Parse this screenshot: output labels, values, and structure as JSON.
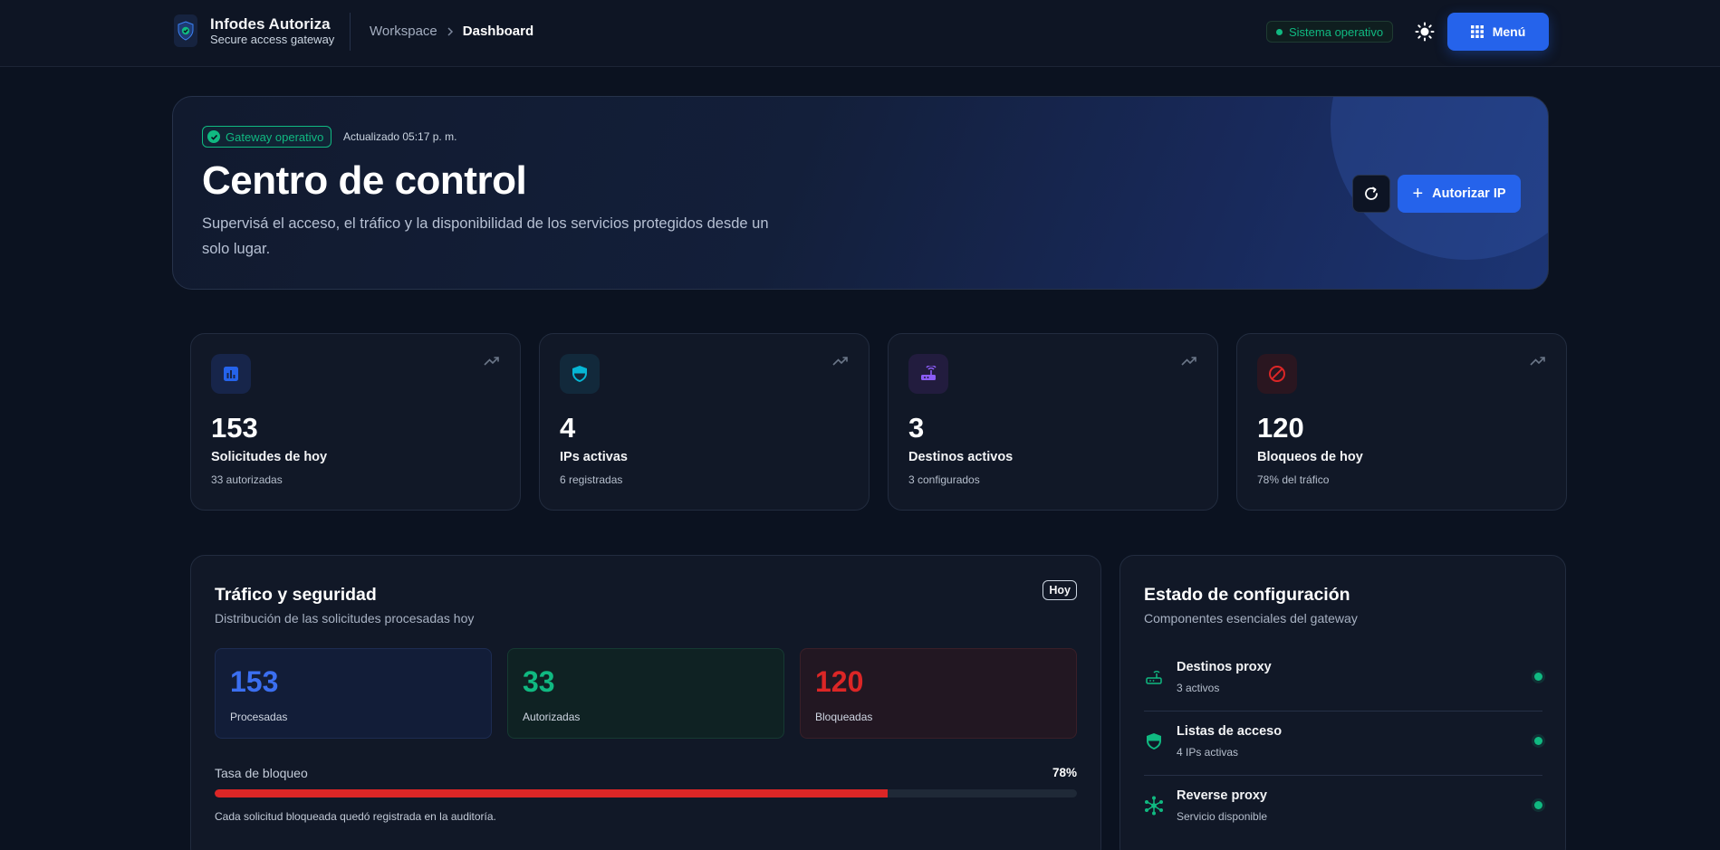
{
  "header": {
    "brand_name": "Infodes Autoriza",
    "brand_subtitle": "Secure access gateway",
    "breadcrumb": [
      "Workspace",
      "Dashboard"
    ],
    "system_status": "Sistema operativo",
    "menu_label": "Menú"
  },
  "hero": {
    "status_badge": "Gateway operativo",
    "updated": "Actualizado 05:17 p. m.",
    "title": "Centro de control",
    "description": "Supervisá el acceso, el tráfico y la disponibilidad de los servicios protegidos desde un solo lugar.",
    "authorize_label": "Autorizar IP"
  },
  "stats": [
    {
      "value": "153",
      "label": "Solicitudes de hoy",
      "sub": "33 autorizadas",
      "icon": "bar-chart-icon",
      "color": "#2563eb"
    },
    {
      "value": "4",
      "label": "IPs activas",
      "sub": "6 registradas",
      "icon": "shield-icon",
      "color": "#06b6d4"
    },
    {
      "value": "3",
      "label": "Destinos activos",
      "sub": "3 configurados",
      "icon": "router-icon",
      "color": "#8b5cf6"
    },
    {
      "value": "120",
      "label": "Bloqueos de hoy",
      "sub": "78% del tráfico",
      "icon": "block-icon",
      "color": "#dc2626"
    }
  ],
  "traffic": {
    "title": "Tráfico y seguridad",
    "subtitle": "Distribución de las solicitudes procesadas hoy",
    "period": "Hoy",
    "metrics": [
      {
        "value": "153",
        "label": "Procesadas",
        "color": "#3b6ff0"
      },
      {
        "value": "33",
        "label": "Autorizadas",
        "color": "#10b981"
      },
      {
        "value": "120",
        "label": "Bloqueadas",
        "color": "#dc2626"
      }
    ],
    "rate_label": "Tasa de bloqueo",
    "rate_value": "78%",
    "rate_fraction": 0.78,
    "note": "Cada solicitud bloqueada quedó registrada en la auditoría."
  },
  "config": {
    "title": "Estado de configuración",
    "subtitle": "Componentes esenciales del gateway",
    "items": [
      {
        "name": "Destinos proxy",
        "sub": "3 activos",
        "icon": "router-icon"
      },
      {
        "name": "Listas de acceso",
        "sub": "4 IPs activas",
        "icon": "shield-icon"
      },
      {
        "name": "Reverse proxy",
        "sub": "Servicio disponible",
        "icon": "network-icon"
      }
    ],
    "status_color": "#10b981"
  }
}
